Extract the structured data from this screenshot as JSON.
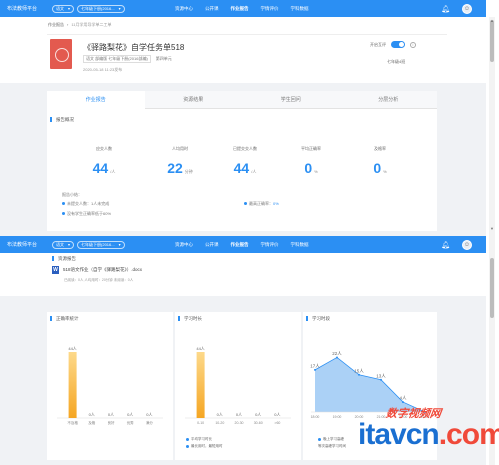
{
  "topbar": {
    "brand": "布法教师平台",
    "subject": "语文",
    "grade": "七年级下册(2016...",
    "nav": [
      "资源中心",
      "公开课",
      "作业报告",
      "学情评价",
      "学科数据"
    ],
    "active_nav": "作业报告"
  },
  "breadcrumb": {
    "home": "作业报告",
    "current": "11月学用导学单二工单"
  },
  "task": {
    "title": "《驿路梨花》自学任务单518",
    "meta": [
      "语文 部编版 七年级下册(2016部编)",
      "第四单元"
    ],
    "date": "2020-05-18 11:23发布",
    "toggle_label": "开启互评",
    "class_label": "七年级4班"
  },
  "tabs": [
    "作业报告",
    "资源结果",
    "学生回问",
    "分层分析"
  ],
  "overview": {
    "title": "报告概况",
    "stats": [
      {
        "label": "应交人数",
        "value": "44",
        "unit": "/人"
      },
      {
        "label": "人均用时",
        "value": "22",
        "unit": "分钟"
      },
      {
        "label": "已提交交人数",
        "value": "44",
        "unit": "/人"
      },
      {
        "label": "平均正确率",
        "value": "0",
        "unit": "%"
      },
      {
        "label": "及格率",
        "value": "0",
        "unit": "%"
      }
    ],
    "notes_title": "报告小结：",
    "note1": "未提交人数：1人未完成",
    "note2_prefix": "最高正确率：",
    "note2_value": "0%",
    "note3": "没有学生正确率低于60%"
  },
  "resource": {
    "title": "资源报告",
    "file": "518语文作业（自学《驿路梨花》）.docx",
    "meta": "已阅读：0人   人均用时：20分钟   未阅读：0人"
  },
  "charts": {
    "accuracy_title": "正确率统计",
    "duration_title": "学习时长",
    "time_title": "学习时段"
  },
  "chart_data": [
    {
      "type": "bar",
      "title": "正确率统计",
      "categories": [
        "不及格",
        "及格",
        "良好",
        "优秀",
        "满分"
      ],
      "values": [
        44,
        0,
        0,
        0,
        0
      ],
      "data_labels": [
        "44人",
        "0人",
        "0人",
        "0人",
        "0人"
      ]
    },
    {
      "type": "bar",
      "title": "学习时长",
      "categories": [
        "0-10",
        "10-20",
        "20-30",
        "30-60",
        ">60"
      ],
      "values": [
        44,
        0,
        0,
        0,
        0
      ],
      "data_labels": [
        "44人",
        "0人",
        "0人",
        "0人",
        "0人"
      ],
      "legend": [
        "平均学习时长",
        "最长用时，最短用时"
      ]
    },
    {
      "type": "area",
      "title": "学习时段",
      "x": [
        "18:00",
        "19:00",
        "20:00",
        "21:00",
        "22:00",
        "23:00"
      ],
      "values": [
        17,
        22,
        15,
        13,
        4,
        0
      ],
      "data_labels": [
        "17人",
        "22人",
        "15人",
        "13人",
        "4人",
        ""
      ],
      "legend": [
        "晚上学习高峰",
        "等次高峰学习时间"
      ],
      "color": "#2b8ff3"
    }
  ],
  "watermark": {
    "cn": "数字视频网",
    "en_pre": "itavcn",
    "en_post": ".com"
  }
}
